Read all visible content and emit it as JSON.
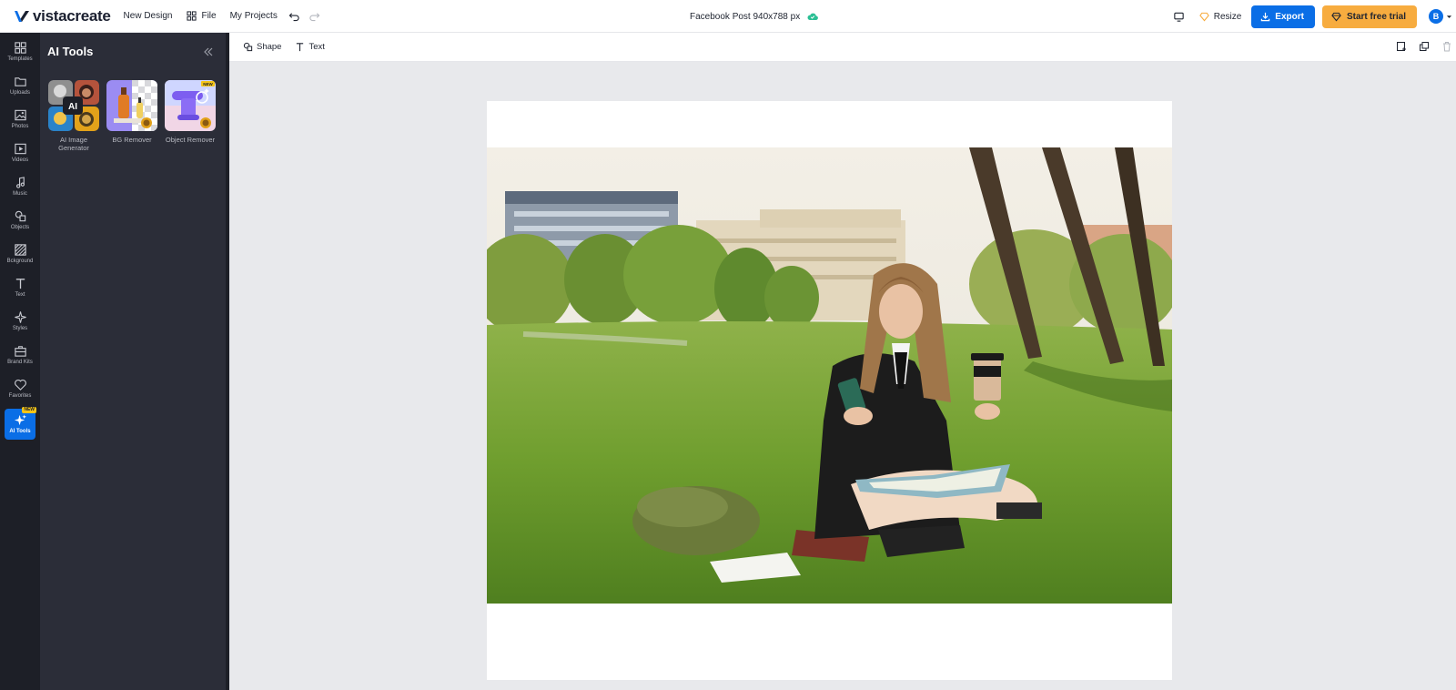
{
  "app": {
    "logo_text": "vistacreate",
    "nav": {
      "new_design": "New Design",
      "file": "File",
      "my_projects": "My Projects"
    },
    "document_title": "Facebook Post 940x788 px",
    "resize_label": "Resize",
    "export_label": "Export",
    "trial_label": "Start free trial",
    "avatar_initial": "B"
  },
  "rail": {
    "items": [
      {
        "label": "Templates",
        "icon": "templates-icon"
      },
      {
        "label": "Uploads",
        "icon": "folder-icon"
      },
      {
        "label": "Photos",
        "icon": "image-icon"
      },
      {
        "label": "Videos",
        "icon": "video-icon"
      },
      {
        "label": "Music",
        "icon": "music-icon"
      },
      {
        "label": "Objects",
        "icon": "shapes-icon"
      },
      {
        "label": "Bckground",
        "icon": "background-icon"
      },
      {
        "label": "Text",
        "icon": "text-icon"
      },
      {
        "label": "Styles",
        "icon": "sparkle-icon"
      },
      {
        "label": "Brand Kits",
        "icon": "briefcase-icon"
      },
      {
        "label": "Favorites",
        "icon": "heart-icon"
      },
      {
        "label": "AI Tools",
        "icon": "ai-sparkle-icon",
        "badge": "NEW",
        "active": true
      }
    ]
  },
  "panel": {
    "title": "AI Tools",
    "tools": [
      {
        "label": "AI Image Generator",
        "thumb_text": "AI"
      },
      {
        "label": "BG Remover"
      },
      {
        "label": "Object Remover",
        "badge": "NEW"
      }
    ]
  },
  "toolbar": {
    "shape_label": "Shape",
    "text_label": "Text"
  },
  "colors": {
    "accent": "#0a6ee6",
    "trial": "#f7ac3f",
    "rail_bg": "#1d1f27",
    "panel_bg": "#2b2d38",
    "workspace_bg": "#e8e9ec",
    "sync_ok": "#2bbf94"
  }
}
